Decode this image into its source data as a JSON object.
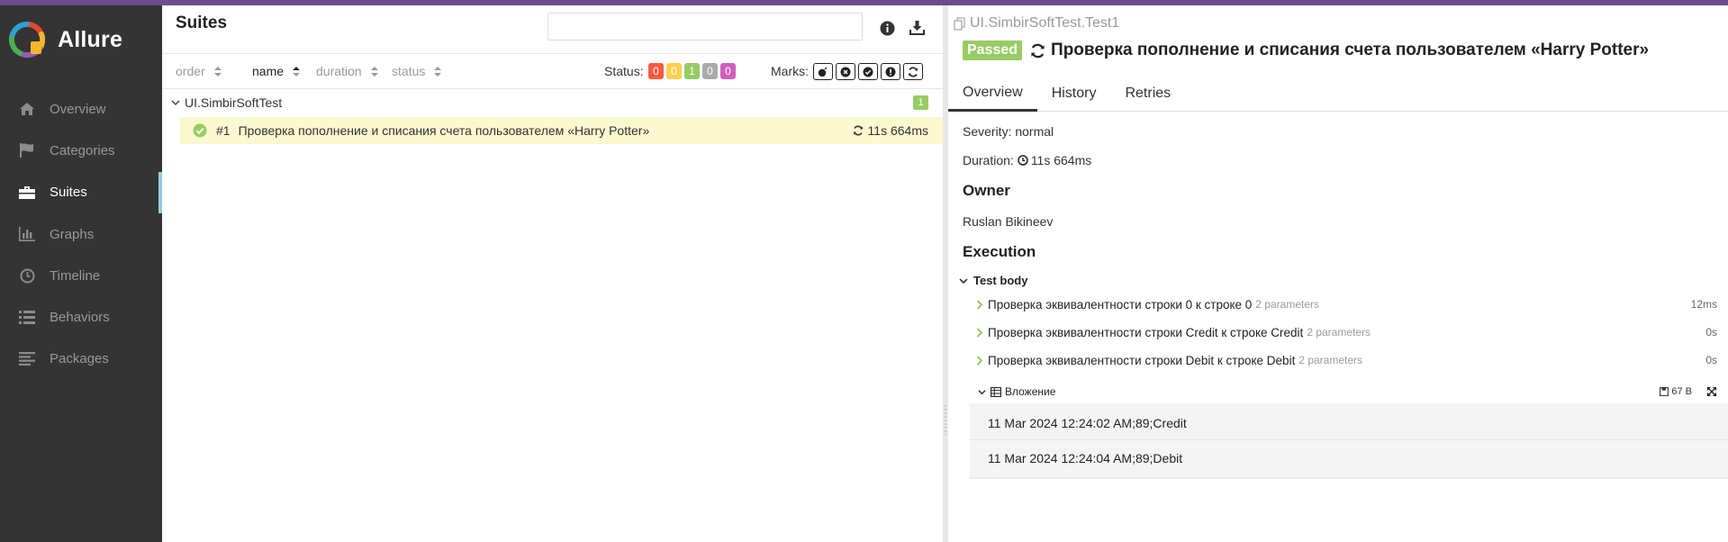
{
  "app": {
    "brand": "Allure"
  },
  "sidebar": {
    "items": [
      {
        "label": "Overview",
        "icon": "home-icon"
      },
      {
        "label": "Categories",
        "icon": "flag-icon"
      },
      {
        "label": "Suites",
        "icon": "briefcase-icon",
        "active": true
      },
      {
        "label": "Graphs",
        "icon": "bar-chart-icon"
      },
      {
        "label": "Timeline",
        "icon": "clock-icon"
      },
      {
        "label": "Behaviors",
        "icon": "list-icon"
      },
      {
        "label": "Packages",
        "icon": "align-left-icon"
      }
    ]
  },
  "suites": {
    "title": "Suites",
    "search": {
      "value": "",
      "placeholder": ""
    },
    "sort": [
      {
        "label": "order"
      },
      {
        "label": "name",
        "active": true
      },
      {
        "label": "duration"
      },
      {
        "label": "status"
      }
    ],
    "status_label": "Status:",
    "status_counts": [
      {
        "status": "failed",
        "count": "0",
        "color": "#fd5a3e"
      },
      {
        "status": "broken",
        "count": "0",
        "color": "#ffd050"
      },
      {
        "status": "passed",
        "count": "1",
        "color": "#97cc64"
      },
      {
        "status": "skipped",
        "count": "0",
        "color": "#aaaaaa"
      },
      {
        "status": "unknown",
        "count": "0",
        "color": "#d35ebe"
      }
    ],
    "marks_label": "Marks:",
    "group": {
      "name": "UI.SimbirSoftTest",
      "count": "1",
      "test": {
        "number": "#1",
        "name": "Проверка пополнение и списания счета пользователем «Harry Potter»",
        "duration": "11s 664ms"
      }
    }
  },
  "result": {
    "breadcrumb": "UI.SimbirSoftTest.Test1",
    "status": "Passed",
    "title": "Проверка пополнение и списания счета пользователем «Harry Potter»",
    "tabs": [
      {
        "label": "Overview",
        "active": true
      },
      {
        "label": "History"
      },
      {
        "label": "Retries"
      }
    ],
    "severity": "Severity: normal",
    "duration_label": "Duration:",
    "duration": "11s 664ms",
    "owner_title": "Owner",
    "owner": "Ruslan Bikineev",
    "execution_title": "Execution",
    "test_body": "Test body",
    "steps": [
      {
        "name": "Проверка эквивалентности строки 0 к строке 0",
        "params": "2 parameters",
        "duration": "12ms"
      },
      {
        "name": "Проверка эквивалентности строки Credit к строке Credit",
        "params": "2 parameters",
        "duration": "0s"
      },
      {
        "name": "Проверка эквивалентности строки Debit к строке Debit",
        "params": "2 parameters",
        "duration": "0s"
      }
    ],
    "attachment": {
      "label": "Вложение",
      "size": "67 B",
      "lines": [
        "11 Mar 2024 12:24:02 AM;89;Credit",
        "11 Mar 2024 12:24:04 AM;89;Debit"
      ]
    },
    "colors": {
      "passed": "#97cc64",
      "accent_bar": "#6a4d8c",
      "selected_row": "#fcf8cf"
    }
  }
}
